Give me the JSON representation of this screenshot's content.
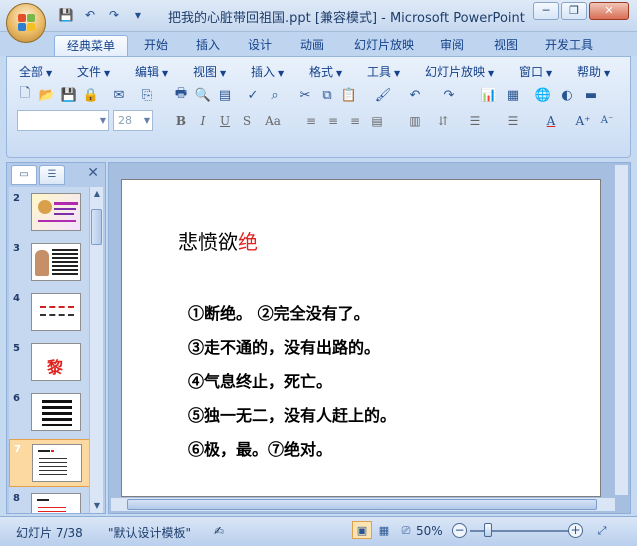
{
  "window": {
    "title": "把我的心脏带回祖国.ppt [兼容模式] - Microsoft PowerPoint",
    "controls": {
      "minimize": "─",
      "restore": "❐",
      "close": "✕"
    }
  },
  "ribbon_tabs": [
    "经典菜单",
    "开始",
    "插入",
    "设计",
    "动画",
    "幻灯片放映",
    "审阅",
    "视图",
    "开发工具"
  ],
  "classic_menu": [
    "全部",
    "文件",
    "编辑",
    "视图",
    "插入",
    "格式",
    "工具",
    "幻灯片放映",
    "窗口",
    "帮助"
  ],
  "format_bar": {
    "font_name": "",
    "font_size": "28"
  },
  "slides_panel": {
    "numbers": [
      "2",
      "3",
      "4",
      "5",
      "6",
      "7",
      "8"
    ],
    "slide5_char": "黎",
    "selected": "7"
  },
  "slide": {
    "title_black": "悲愤欲",
    "title_red": "绝",
    "lines": [
      "①断绝。    ②完全没有了。",
      "③走不通的，没有出路的。",
      "④气息终止，死亡。",
      "⑤独一无二，没有人赶上的。",
      "⑥极，最。⑦绝对。"
    ]
  },
  "status_bar": {
    "slide_pos": "幻灯片 7/38",
    "template": "\"默认设计模板\"",
    "zoom": "50%"
  },
  "colors": {
    "accent": "#e0231f",
    "ribbon": "#d4e3f6"
  }
}
